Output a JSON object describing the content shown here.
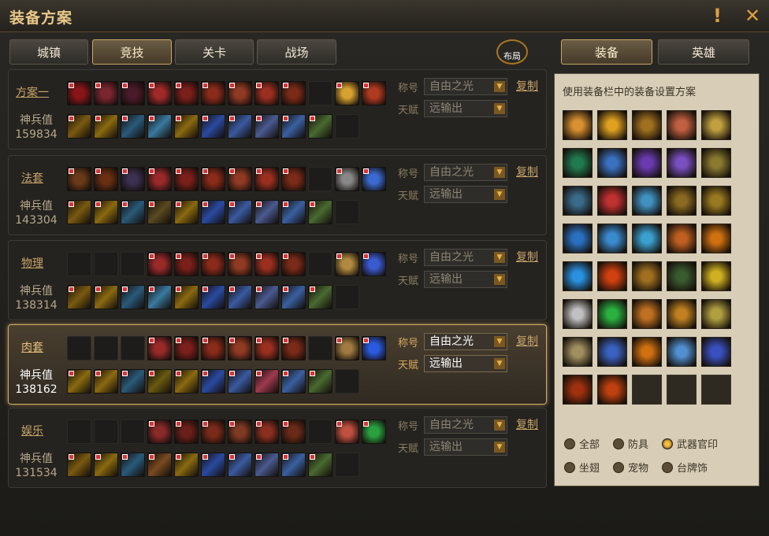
{
  "window": {
    "title": "装备方案"
  },
  "top_tabs": [
    {
      "label": "城镇",
      "active": false
    },
    {
      "label": "竞技",
      "active": true
    },
    {
      "label": "关卡",
      "active": false
    },
    {
      "label": "战场",
      "active": false
    }
  ],
  "buju_label": "布局",
  "right_tabs": [
    {
      "label": "装备",
      "active": true
    },
    {
      "label": "英雄",
      "active": false
    }
  ],
  "sets": [
    {
      "name": "方案一",
      "power_label": "神兵值",
      "power": "159834",
      "title_label": "称号",
      "title_value": "自由之光",
      "talent_label": "天赋",
      "talent_value": "远输出",
      "copy": "复制",
      "selected": false
    },
    {
      "name": "法套",
      "power_label": "神兵值",
      "power": "143304",
      "title_label": "称号",
      "title_value": "自由之光",
      "talent_label": "天赋",
      "talent_value": "远输出",
      "copy": "复制",
      "selected": false
    },
    {
      "name": "物理",
      "power_label": "神兵值",
      "power": "138314",
      "title_label": "称号",
      "title_value": "自由之光",
      "talent_label": "天赋",
      "talent_value": "远输出",
      "copy": "复制",
      "selected": false
    },
    {
      "name": "肉套",
      "power_label": "神兵值",
      "power": "138162",
      "title_label": "称号",
      "title_value": "自由之光",
      "talent_label": "天赋",
      "talent_value": "远输出",
      "copy": "复制",
      "selected": true
    },
    {
      "name": "娱乐",
      "power_label": "神兵值",
      "power": "131534",
      "title_label": "称号",
      "title_value": "自由之光",
      "talent_label": "天赋",
      "talent_value": "远输出",
      "copy": "复制",
      "selected": false
    }
  ],
  "slot_colors": {
    "row1": [
      [
        "#8a1518",
        "#7a2630",
        "#4a1a2a",
        "#a02a2a",
        "#7a1f1a",
        "#8a2a1a",
        "#903a24",
        "#9a2f20",
        "#7a2a18",
        "#1e1d1b",
        "#d8a030",
        "#b03a20"
      ],
      [
        "#6a3a18",
        "#6a2e12",
        "#3a3050",
        "#9a2a2a",
        "#7a1f1a",
        "#8a2a1a",
        "#903a24",
        "#9a2f20",
        "#7a2a18",
        "#1e1d1b",
        "#888888",
        "#3a6ad0"
      ],
      [
        "#1e1d1b",
        "#1e1d1b",
        "#1e1d1b",
        "#9a2a2a",
        "#7a1f1a",
        "#8a2a1a",
        "#903a24",
        "#9a2f20",
        "#7a2a18",
        "#1e1d1b",
        "#b08a40",
        "#3a5ad0"
      ],
      [
        "#1e1d1b",
        "#1e1d1b",
        "#1e1d1b",
        "#9a2a2a",
        "#7a1f1a",
        "#8a2a1a",
        "#903a24",
        "#9a2f20",
        "#7a2a18",
        "#1e1d1b",
        "#a07a40",
        "#2a5ae0"
      ],
      [
        "#1e1d1b",
        "#1e1d1b",
        "#1e1d1b",
        "#8a2a2a",
        "#6a1f1a",
        "#7a2a1a",
        "#803a24",
        "#8a2f20",
        "#6a2a18",
        "#1e1d1b",
        "#c05040",
        "#2aa040"
      ]
    ],
    "row2": [
      [
        "#7a5a10",
        "#8a6a10",
        "#2a5a7a",
        "#3a7aa0",
        "#8a6a10",
        "#2a4aa0",
        "#3a5aa0",
        "#4a5a90",
        "#3a60a0",
        "#4a6a30",
        "#1e1d1b"
      ],
      [
        "#7a5a10",
        "#8a6a10",
        "#2a5a7a",
        "#5a4a20",
        "#8a6a10",
        "#2a4aa0",
        "#3a5aa0",
        "#4a5a90",
        "#3a60a0",
        "#4a6a30",
        "#1e1d1b"
      ],
      [
        "#7a5a10",
        "#8a6a10",
        "#2a5a7a",
        "#3a7aa0",
        "#8a6a10",
        "#2a4aa0",
        "#3a5aa0",
        "#4a5a90",
        "#3a60a0",
        "#4a6a30",
        "#1e1d1b"
      ],
      [
        "#8a6a10",
        "#8a6a10",
        "#2a5a7a",
        "#6a5a10",
        "#8a6a10",
        "#2a4aa0",
        "#3a5aa0",
        "#a03a50",
        "#3a60a0",
        "#4a6a30",
        "#1e1d1b"
      ],
      [
        "#7a5a10",
        "#8a6a10",
        "#2a5a7a",
        "#7a4a20",
        "#8a6a10",
        "#2a4aa0",
        "#3a5aa0",
        "#4a5a90",
        "#3a60a0",
        "#4a6a30",
        "#1e1d1b"
      ]
    ]
  },
  "inventory": {
    "caption": "使用装备栏中的装备设置方案",
    "colors": [
      [
        "#d89030",
        "#e0a020",
        "#a07020",
        "#c06040",
        "#c0a040"
      ],
      [
        "#207a50",
        "#3a70c0",
        "#6a3ab0",
        "#7a50c0",
        "#8a7a30"
      ],
      [
        "#3a6a8a",
        "#c03030",
        "#4090c0",
        "#8a6a20",
        "#9a7a20"
      ],
      [
        "#2a70c0",
        "#3a8ad0",
        "#3aa0d0",
        "#c06020",
        "#d07010"
      ],
      [
        "#2a90e0",
        "#d04010",
        "#a07020",
        "#3a5a30",
        "#d0b020"
      ],
      [
        "#c0c0c0",
        "#2ab040",
        "#c07020",
        "#c08020",
        "#b0a040"
      ],
      [
        "#a09060",
        "#3a60c0",
        "#d07010",
        "#5090d0",
        "#3a50c0"
      ],
      [
        "#a03010",
        "#c04010",
        "",
        "",
        ""
      ]
    ]
  },
  "filters": [
    {
      "label": "全部",
      "on": false
    },
    {
      "label": "防具",
      "on": false
    },
    {
      "label": "武器官印",
      "on": true
    },
    {
      "label": "坐翅",
      "on": false
    },
    {
      "label": "宠物",
      "on": false
    },
    {
      "label": "台牌饰",
      "on": false
    }
  ],
  "colors": {
    "accent": "#c8a46a",
    "title": "#e9c88a",
    "panel": "#d8cdb6"
  }
}
